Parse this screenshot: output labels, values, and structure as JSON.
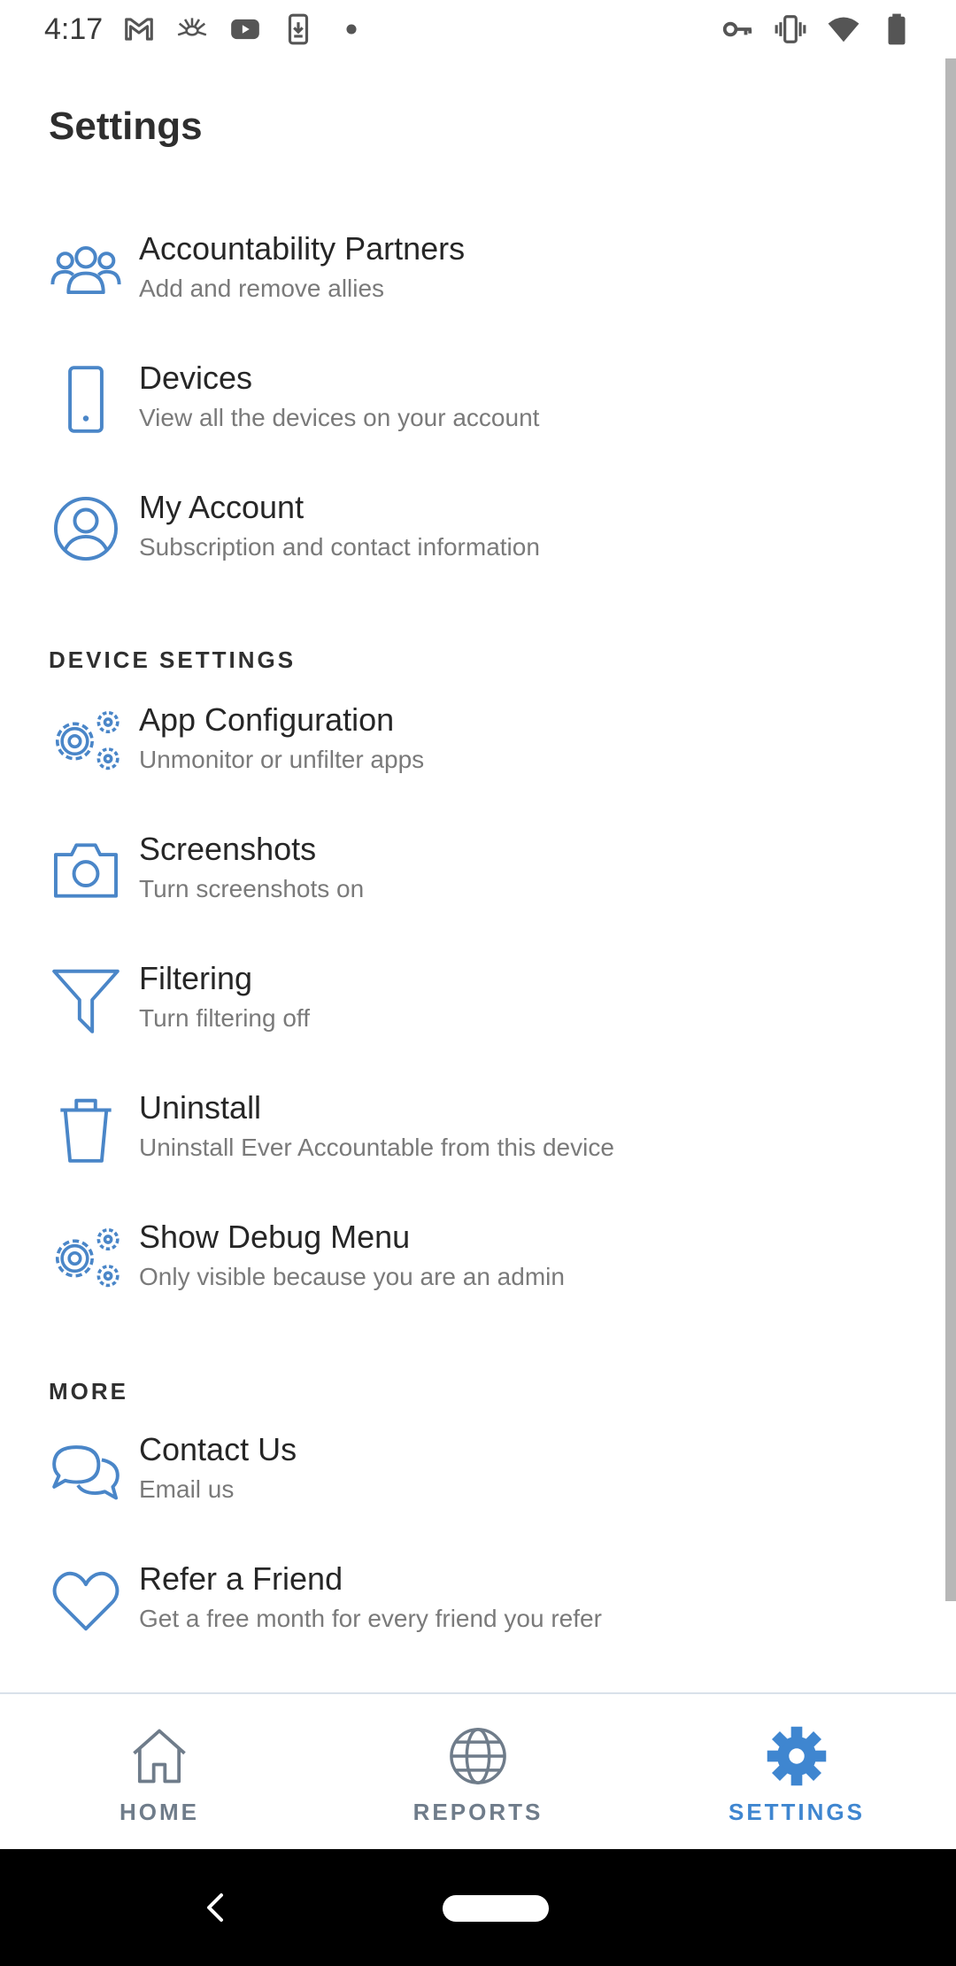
{
  "status_bar": {
    "time": "4:17",
    "left_icons": [
      "gmail-icon",
      "app-bug-icon",
      "youtube-icon",
      "download-icon",
      "dot-icon"
    ],
    "right_icons": [
      "vpn-key-icon",
      "vibrate-icon",
      "wifi-icon",
      "battery-icon"
    ]
  },
  "page": {
    "title": "Settings"
  },
  "account_items": [
    {
      "title": "Accountability Partners",
      "subtitle": "Add and remove allies",
      "icon": "people-icon"
    },
    {
      "title": "Devices",
      "subtitle": "View all the devices on your account",
      "icon": "phone-icon"
    },
    {
      "title": "My Account",
      "subtitle": "Subscription and contact information",
      "icon": "user-circle-icon"
    }
  ],
  "device_settings": {
    "header": "DEVICE SETTINGS",
    "items": [
      {
        "title": "App Configuration",
        "subtitle": "Unmonitor or unfilter apps",
        "icon": "gears-icon"
      },
      {
        "title": "Screenshots",
        "subtitle": "Turn screenshots on",
        "icon": "camera-icon"
      },
      {
        "title": "Filtering",
        "subtitle": "Turn filtering off",
        "icon": "funnel-icon"
      },
      {
        "title": "Uninstall",
        "subtitle": "Uninstall Ever Accountable from this device",
        "icon": "trash-icon"
      },
      {
        "title": "Show Debug Menu",
        "subtitle": "Only visible because you are an admin",
        "icon": "gears-icon"
      }
    ]
  },
  "more": {
    "header": "MORE",
    "items": [
      {
        "title": "Contact Us",
        "subtitle": "Email us",
        "icon": "chat-bubbles-icon"
      },
      {
        "title": "Refer a Friend",
        "subtitle": "Get a free month for every friend you refer",
        "icon": "heart-icon"
      }
    ]
  },
  "bottom_nav": {
    "tabs": [
      {
        "label": "HOME",
        "icon": "home-icon",
        "active": false
      },
      {
        "label": "REPORTS",
        "icon": "globe-icon",
        "active": false
      },
      {
        "label": "SETTINGS",
        "icon": "gear-icon",
        "active": true
      }
    ]
  },
  "colors": {
    "accent": "#4a86c8",
    "tab_inactive": "#6f7c8a",
    "tab_active": "#3f86d0",
    "text_primary": "#262626",
    "text_secondary": "#7a7a7a"
  }
}
